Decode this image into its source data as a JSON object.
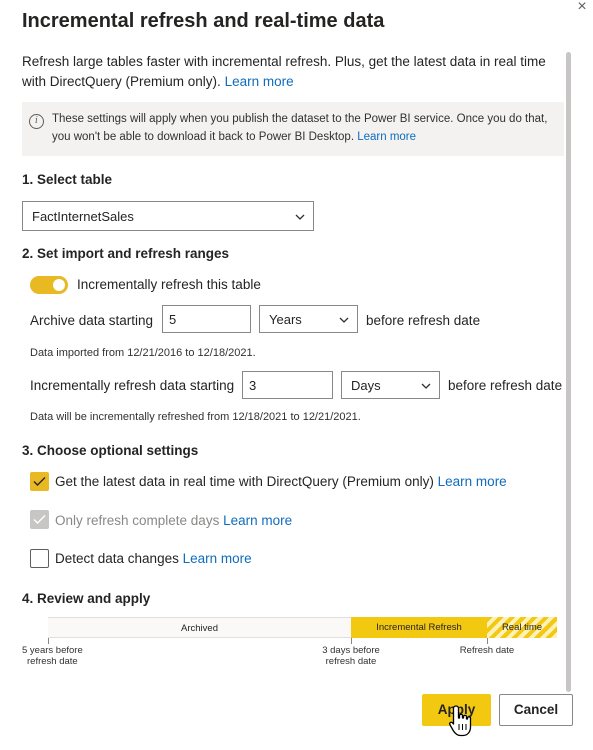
{
  "dialog": {
    "title": "Incremental refresh and real-time data",
    "intro_text": "Refresh large tables faster with incremental refresh. Plus, get the latest data in real time with DirectQuery (Premium only).",
    "intro_link": "Learn more",
    "info_icon": "info-icon",
    "info_text": "These settings will apply when you publish the dataset to the Power BI service. Once you do that, you won't be able to download it back to Power BI Desktop.",
    "info_link": "Learn more",
    "close_icon": "×"
  },
  "section1": {
    "heading": "1. Select table",
    "table_select": "FactInternetSales"
  },
  "section2": {
    "heading": "2. Set import and refresh ranges",
    "toggle_label": "Incrementally refresh this table",
    "toggle_on": true,
    "archive_label": "Archive data starting",
    "archive_value": "5",
    "archive_unit": "Years",
    "archive_suffix": "before refresh date",
    "archive_note": "Data imported from 12/21/2016 to 12/18/2021.",
    "incremental_label": "Incrementally refresh data starting",
    "incremental_value": "3",
    "incremental_unit": "Days",
    "incremental_suffix": "before refresh date",
    "incremental_note": "Data will be incrementally refreshed from 12/18/2021 to 12/21/2021."
  },
  "section3": {
    "heading": "3. Choose optional settings",
    "realtime_label": "Get the latest data in real time with DirectQuery (Premium only)",
    "realtime_link": "Learn more",
    "complete_days_label": "Only refresh complete days",
    "complete_days_link": "Learn more",
    "detect_changes_label": "Detect data changes",
    "detect_changes_link": "Learn more"
  },
  "section4": {
    "heading": "4. Review and apply",
    "bar_archived": "Archived",
    "bar_incremental": "Incremental Refresh",
    "bar_realtime": "Real time",
    "tick_1_line1": "5 years before",
    "tick_1_line2": "refresh date",
    "tick_2_line1": "3 days before",
    "tick_2_line2": "refresh date",
    "tick_3": "Refresh date"
  },
  "footer": {
    "apply_label": "Apply",
    "cancel_label": "Cancel"
  },
  "colors": {
    "accent": "#f2c811",
    "toggle": "#e8b923",
    "link": "#0f6cbd",
    "info_bg": "#f3f2f1"
  }
}
